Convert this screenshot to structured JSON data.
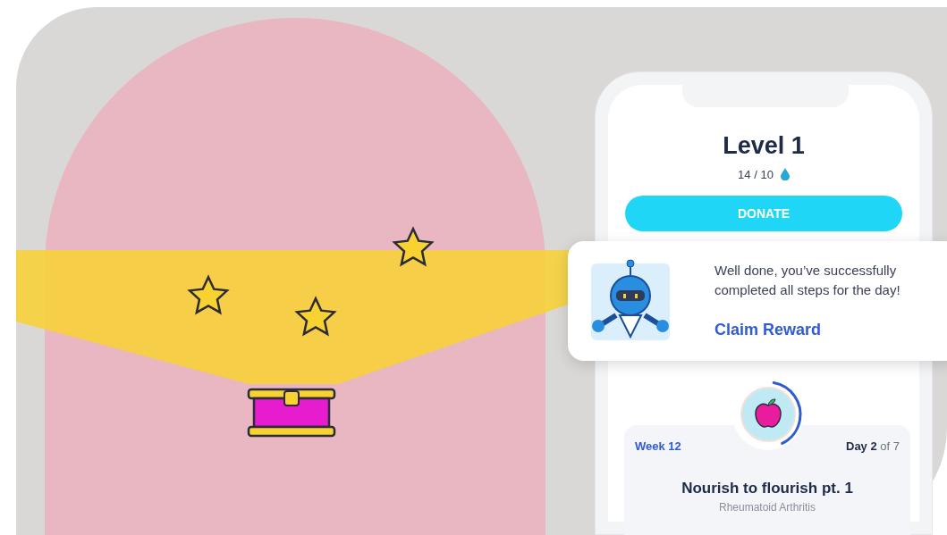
{
  "phone": {
    "title": "Level 1",
    "progress": "14 / 10",
    "donate_button": "DONATE"
  },
  "reward_card": {
    "message": "Well done, you’ve successfully completed all steps for the day!",
    "claim_link": "Claim Reward"
  },
  "lesson": {
    "level": 0.4,
    "week": "Week 12",
    "day": "**Day 2** of 7",
    "title": "Nourish to flourish pt. 1",
    "subtitle": "Rheumatoid Arthritis"
  }
}
